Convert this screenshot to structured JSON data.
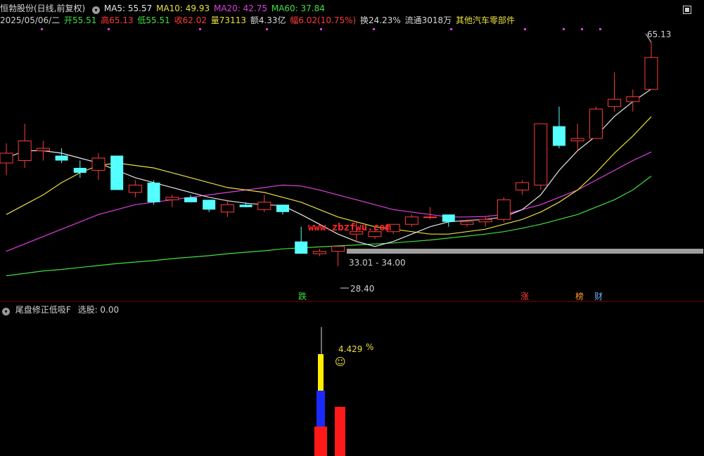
{
  "header": {
    "stock": "恒勃股份(日线,前复权)",
    "ma5_label": "MA5: 55.57",
    "ma10_label": "MA10: 49.93",
    "ma20_label": "MA20: 42.75",
    "ma60_label": "MA60: 37.84",
    "date": "2025/05/06/二",
    "open": "开55.51",
    "high": "高65.13",
    "low": "低55.51",
    "close": "收62.02",
    "volume": "量73113",
    "amount": "额4.33亿",
    "change": "幅6.02(10.75%)",
    "turnover": "换24.23%",
    "float": "流通3018万",
    "sector": "其他汽车零部件"
  },
  "colors": {
    "up": "#ff3b3b",
    "down": "#55ffff",
    "ma5": "#e6e6e6",
    "ma10": "#e8e040",
    "ma20": "#e040e0",
    "ma60": "#40e040",
    "band": "#9e9e9e"
  },
  "watermark": "www.zbzfwu.com",
  "annotations": {
    "high_label": "65.13",
    "low_label": "28.40",
    "range_label": "33.01 - 34.00",
    "tag_die": "跌",
    "tag_zhang": "涨",
    "tag_bang": "榜",
    "tag_cai": "财"
  },
  "indicator": {
    "title": "尾盘修正低吸F",
    "select_label": "选股: 0.00",
    "pct_value": "4.429",
    "pct_sign": "%",
    "smiley_icon": "smiley-icon"
  },
  "chart_data": {
    "type": "candlestick",
    "candles": [
      {
        "o": 40.5,
        "h": 44.5,
        "l": 38.0,
        "c": 42.5
      },
      {
        "o": 41.0,
        "h": 48.5,
        "l": 39.5,
        "c": 45.0
      },
      {
        "o": 43.0,
        "h": 45.0,
        "l": 41.0,
        "c": 43.5
      },
      {
        "o": 42.0,
        "h": 43.5,
        "l": 40.5,
        "c": 41.0
      },
      {
        "o": 39.5,
        "h": 41.0,
        "l": 37.5,
        "c": 38.5
      },
      {
        "o": 39.0,
        "h": 42.5,
        "l": 37.0,
        "c": 41.5
      },
      {
        "o": 42.0,
        "h": 42.0,
        "l": 35.0,
        "c": 35.0
      },
      {
        "o": 34.5,
        "h": 37.0,
        "l": 33.5,
        "c": 36.0
      },
      {
        "o": 36.5,
        "h": 37.0,
        "l": 32.0,
        "c": 32.5
      },
      {
        "o": 33.0,
        "h": 34.0,
        "l": 31.5,
        "c": 33.5
      },
      {
        "o": 33.5,
        "h": 34.0,
        "l": 32.5,
        "c": 32.5
      },
      {
        "o": 33.0,
        "h": 33.0,
        "l": 30.5,
        "c": 31.0
      },
      {
        "o": 30.5,
        "h": 33.0,
        "l": 29.5,
        "c": 32.0
      },
      {
        "o": 32.0,
        "h": 32.5,
        "l": 31.5,
        "c": 31.5
      },
      {
        "o": 31.0,
        "h": 34.0,
        "l": 30.5,
        "c": 32.5
      },
      {
        "o": 32.0,
        "h": 32.0,
        "l": 30.0,
        "c": 30.5
      },
      {
        "o": 24.5,
        "h": 27.5,
        "l": 23.5,
        "c": 22.0
      },
      {
        "o": 22.0,
        "h": 23.0,
        "l": 21.5,
        "c": 22.5
      },
      {
        "o": 22.5,
        "h": 23.0,
        "l": 19.5,
        "c": 23.5
      },
      {
        "o": 26.0,
        "h": 28.4,
        "l": 24.5,
        "c": 26.5
      },
      {
        "o": 25.5,
        "h": 27.0,
        "l": 25.0,
        "c": 26.5
      },
      {
        "o": 26.5,
        "h": 28.0,
        "l": 26.0,
        "c": 28.0
      },
      {
        "o": 28.0,
        "h": 30.0,
        "l": 27.5,
        "c": 29.5
      },
      {
        "o": 29.5,
        "h": 31.5,
        "l": 29.0,
        "c": 29.5
      },
      {
        "o": 30.0,
        "h": 30.0,
        "l": 27.5,
        "c": 28.5
      },
      {
        "o": 28.0,
        "h": 29.0,
        "l": 27.5,
        "c": 28.5
      },
      {
        "o": 28.5,
        "h": 29.5,
        "l": 27.5,
        "c": 29.0
      },
      {
        "o": 29.0,
        "h": 33.5,
        "l": 28.5,
        "c": 33.0
      },
      {
        "o": 35.0,
        "h": 37.0,
        "l": 34.0,
        "c": 36.5
      },
      {
        "o": 36.0,
        "h": 48.5,
        "l": 35.0,
        "c": 48.5
      },
      {
        "o": 48.0,
        "h": 52.0,
        "l": 43.5,
        "c": 44.0
      },
      {
        "o": 45.0,
        "h": 48.5,
        "l": 43.0,
        "c": 45.5
      },
      {
        "o": 45.5,
        "h": 52.0,
        "l": 45.5,
        "c": 51.5
      },
      {
        "o": 52.0,
        "h": 59.0,
        "l": 51.0,
        "c": 53.5
      },
      {
        "o": 53.0,
        "h": 55.5,
        "l": 51.0,
        "c": 54.0
      },
      {
        "o": 55.51,
        "h": 65.13,
        "l": 55.51,
        "c": 62.02
      }
    ],
    "ma5": [
      41.5,
      43.0,
      43.0,
      42.5,
      41.5,
      40.5,
      39.0,
      37.5,
      36.5,
      35.5,
      34.5,
      33.5,
      32.8,
      32.3,
      32.0,
      31.8,
      30.0,
      28.0,
      26.0,
      24.5,
      23.5,
      24.5,
      26.0,
      27.5,
      28.5,
      28.8,
      29.0,
      29.5,
      31.0,
      34.0,
      39.0,
      43.0,
      46.0,
      50.0,
      53.0,
      55.57
    ],
    "ma10": [
      30.0,
      32.0,
      34.0,
      36.5,
      38.5,
      40.0,
      40.5,
      40.0,
      39.5,
      38.5,
      37.5,
      36.5,
      35.5,
      35.0,
      34.5,
      33.5,
      32.5,
      31.0,
      29.5,
      28.5,
      27.5,
      27.0,
      26.5,
      26.0,
      26.0,
      26.5,
      27.0,
      28.0,
      29.0,
      30.5,
      32.5,
      35.0,
      38.5,
      42.5,
      46.0,
      49.93
    ],
    "ma20": [
      22.5,
      24.0,
      25.5,
      27.0,
      28.5,
      30.0,
      31.0,
      32.0,
      32.5,
      33.0,
      33.5,
      34.0,
      34.5,
      35.0,
      35.5,
      36.0,
      35.8,
      35.0,
      34.0,
      33.0,
      32.0,
      31.0,
      30.5,
      30.0,
      29.5,
      29.5,
      29.6,
      30.0,
      31.0,
      32.0,
      33.5,
      35.0,
      37.0,
      39.0,
      41.0,
      42.75
    ],
    "ma60": [
      17.5,
      18.0,
      18.5,
      18.8,
      19.2,
      19.6,
      20.0,
      20.3,
      20.6,
      21.0,
      21.3,
      21.6,
      22.0,
      22.3,
      22.6,
      23.0,
      23.2,
      23.4,
      23.6,
      23.8,
      24.0,
      24.2,
      24.5,
      24.8,
      25.2,
      25.6,
      26.0,
      26.5,
      27.2,
      28.0,
      29.0,
      30.0,
      31.5,
      33.0,
      35.0,
      37.84
    ],
    "y_range": [
      15,
      68
    ],
    "indicator_bars": [
      {
        "x_index": 16,
        "red": 1.2,
        "blue": 1.5,
        "yellow": 1.6,
        "white": 1.7
      },
      {
        "x_index": 17,
        "red": 2.1
      }
    ]
  }
}
